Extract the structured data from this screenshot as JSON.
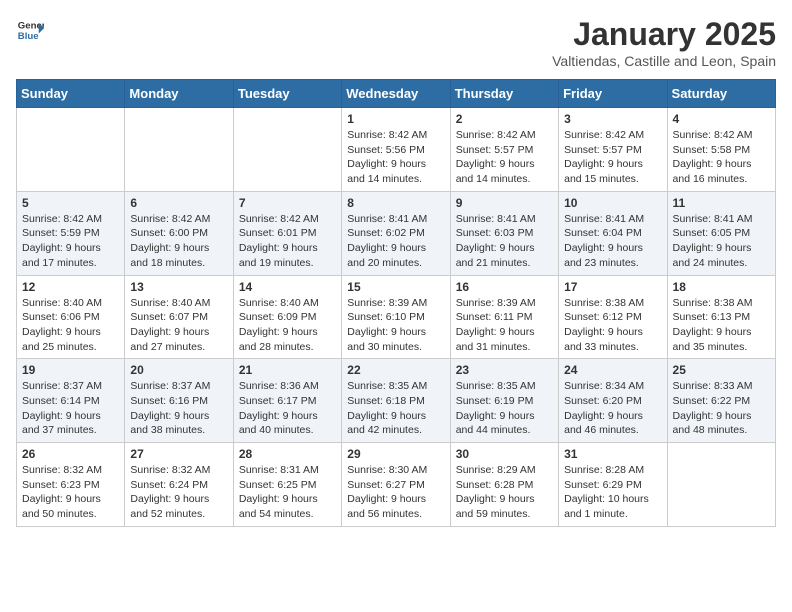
{
  "header": {
    "logo_general": "General",
    "logo_blue": "Blue",
    "title": "January 2025",
    "subtitle": "Valtiendas, Castille and Leon, Spain"
  },
  "calendar": {
    "days_of_week": [
      "Sunday",
      "Monday",
      "Tuesday",
      "Wednesday",
      "Thursday",
      "Friday",
      "Saturday"
    ],
    "weeks": [
      [
        {
          "day": "",
          "info": ""
        },
        {
          "day": "",
          "info": ""
        },
        {
          "day": "",
          "info": ""
        },
        {
          "day": "1",
          "info": "Sunrise: 8:42 AM\nSunset: 5:56 PM\nDaylight: 9 hours\nand 14 minutes."
        },
        {
          "day": "2",
          "info": "Sunrise: 8:42 AM\nSunset: 5:57 PM\nDaylight: 9 hours\nand 14 minutes."
        },
        {
          "day": "3",
          "info": "Sunrise: 8:42 AM\nSunset: 5:57 PM\nDaylight: 9 hours\nand 15 minutes."
        },
        {
          "day": "4",
          "info": "Sunrise: 8:42 AM\nSunset: 5:58 PM\nDaylight: 9 hours\nand 16 minutes."
        }
      ],
      [
        {
          "day": "5",
          "info": "Sunrise: 8:42 AM\nSunset: 5:59 PM\nDaylight: 9 hours\nand 17 minutes."
        },
        {
          "day": "6",
          "info": "Sunrise: 8:42 AM\nSunset: 6:00 PM\nDaylight: 9 hours\nand 18 minutes."
        },
        {
          "day": "7",
          "info": "Sunrise: 8:42 AM\nSunset: 6:01 PM\nDaylight: 9 hours\nand 19 minutes."
        },
        {
          "day": "8",
          "info": "Sunrise: 8:41 AM\nSunset: 6:02 PM\nDaylight: 9 hours\nand 20 minutes."
        },
        {
          "day": "9",
          "info": "Sunrise: 8:41 AM\nSunset: 6:03 PM\nDaylight: 9 hours\nand 21 minutes."
        },
        {
          "day": "10",
          "info": "Sunrise: 8:41 AM\nSunset: 6:04 PM\nDaylight: 9 hours\nand 23 minutes."
        },
        {
          "day": "11",
          "info": "Sunrise: 8:41 AM\nSunset: 6:05 PM\nDaylight: 9 hours\nand 24 minutes."
        }
      ],
      [
        {
          "day": "12",
          "info": "Sunrise: 8:40 AM\nSunset: 6:06 PM\nDaylight: 9 hours\nand 25 minutes."
        },
        {
          "day": "13",
          "info": "Sunrise: 8:40 AM\nSunset: 6:07 PM\nDaylight: 9 hours\nand 27 minutes."
        },
        {
          "day": "14",
          "info": "Sunrise: 8:40 AM\nSunset: 6:09 PM\nDaylight: 9 hours\nand 28 minutes."
        },
        {
          "day": "15",
          "info": "Sunrise: 8:39 AM\nSunset: 6:10 PM\nDaylight: 9 hours\nand 30 minutes."
        },
        {
          "day": "16",
          "info": "Sunrise: 8:39 AM\nSunset: 6:11 PM\nDaylight: 9 hours\nand 31 minutes."
        },
        {
          "day": "17",
          "info": "Sunrise: 8:38 AM\nSunset: 6:12 PM\nDaylight: 9 hours\nand 33 minutes."
        },
        {
          "day": "18",
          "info": "Sunrise: 8:38 AM\nSunset: 6:13 PM\nDaylight: 9 hours\nand 35 minutes."
        }
      ],
      [
        {
          "day": "19",
          "info": "Sunrise: 8:37 AM\nSunset: 6:14 PM\nDaylight: 9 hours\nand 37 minutes."
        },
        {
          "day": "20",
          "info": "Sunrise: 8:37 AM\nSunset: 6:16 PM\nDaylight: 9 hours\nand 38 minutes."
        },
        {
          "day": "21",
          "info": "Sunrise: 8:36 AM\nSunset: 6:17 PM\nDaylight: 9 hours\nand 40 minutes."
        },
        {
          "day": "22",
          "info": "Sunrise: 8:35 AM\nSunset: 6:18 PM\nDaylight: 9 hours\nand 42 minutes."
        },
        {
          "day": "23",
          "info": "Sunrise: 8:35 AM\nSunset: 6:19 PM\nDaylight: 9 hours\nand 44 minutes."
        },
        {
          "day": "24",
          "info": "Sunrise: 8:34 AM\nSunset: 6:20 PM\nDaylight: 9 hours\nand 46 minutes."
        },
        {
          "day": "25",
          "info": "Sunrise: 8:33 AM\nSunset: 6:22 PM\nDaylight: 9 hours\nand 48 minutes."
        }
      ],
      [
        {
          "day": "26",
          "info": "Sunrise: 8:32 AM\nSunset: 6:23 PM\nDaylight: 9 hours\nand 50 minutes."
        },
        {
          "day": "27",
          "info": "Sunrise: 8:32 AM\nSunset: 6:24 PM\nDaylight: 9 hours\nand 52 minutes."
        },
        {
          "day": "28",
          "info": "Sunrise: 8:31 AM\nSunset: 6:25 PM\nDaylight: 9 hours\nand 54 minutes."
        },
        {
          "day": "29",
          "info": "Sunrise: 8:30 AM\nSunset: 6:27 PM\nDaylight: 9 hours\nand 56 minutes."
        },
        {
          "day": "30",
          "info": "Sunrise: 8:29 AM\nSunset: 6:28 PM\nDaylight: 9 hours\nand 59 minutes."
        },
        {
          "day": "31",
          "info": "Sunrise: 8:28 AM\nSunset: 6:29 PM\nDaylight: 10 hours\nand 1 minute."
        },
        {
          "day": "",
          "info": ""
        }
      ]
    ]
  }
}
